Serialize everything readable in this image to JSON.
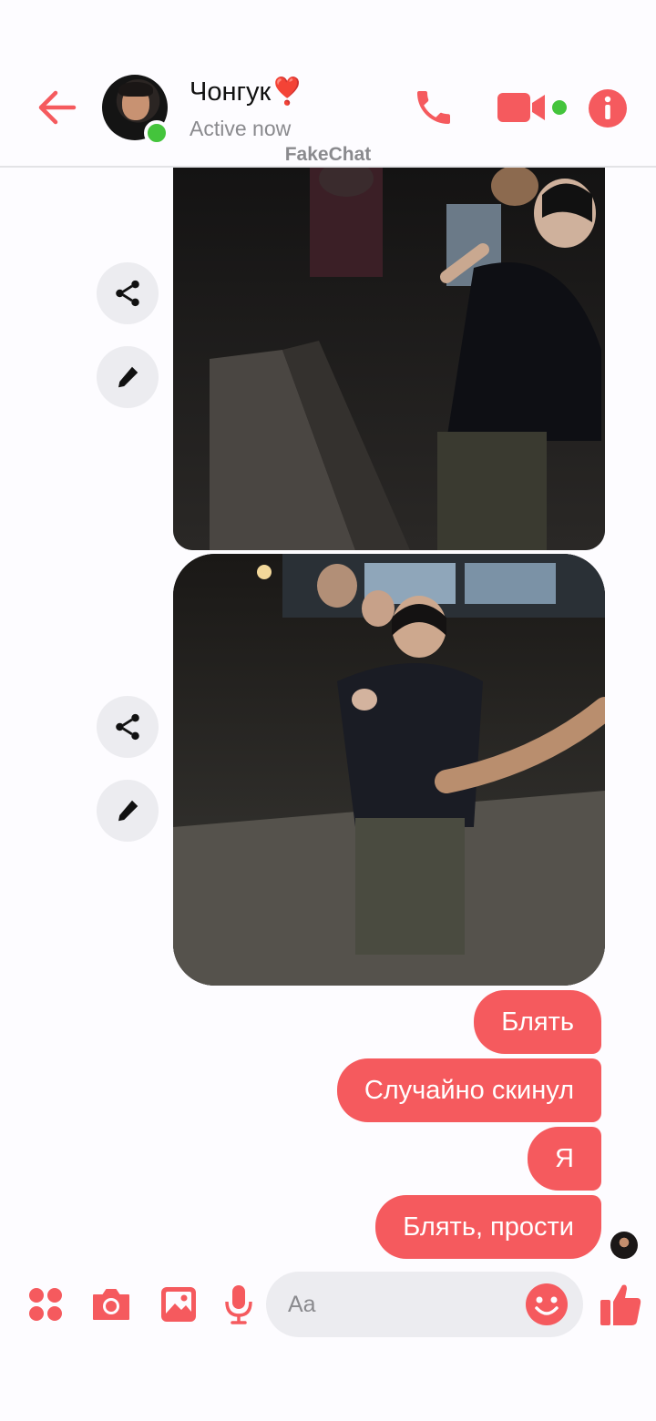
{
  "theme": {
    "accent": "#f55a5e",
    "online": "#44c43c",
    "bubble_text": "#ffffff"
  },
  "header": {
    "back_icon": "arrow-left-icon",
    "contact_name": "Чонгук❣️",
    "status": "Active now",
    "watermark": "FakeChat",
    "call_icon": "phone-icon",
    "video_icon": "video-camera-icon",
    "info_icon": "info-icon"
  },
  "messages": {
    "photos": [
      {
        "side_actions": [
          "share-icon",
          "edit-pencil-icon"
        ]
      },
      {
        "side_actions": [
          "share-icon",
          "edit-pencil-icon"
        ]
      }
    ],
    "bubbles": [
      {
        "text": "Блять"
      },
      {
        "text": "Случайно скинул"
      },
      {
        "text": "Я"
      },
      {
        "text": "Блять, прости"
      }
    ]
  },
  "composer": {
    "placeholder": "Aa",
    "icons": [
      "apps-icon",
      "camera-icon",
      "image-icon",
      "microphone-icon",
      "emoji-icon",
      "thumbs-up-icon"
    ]
  }
}
